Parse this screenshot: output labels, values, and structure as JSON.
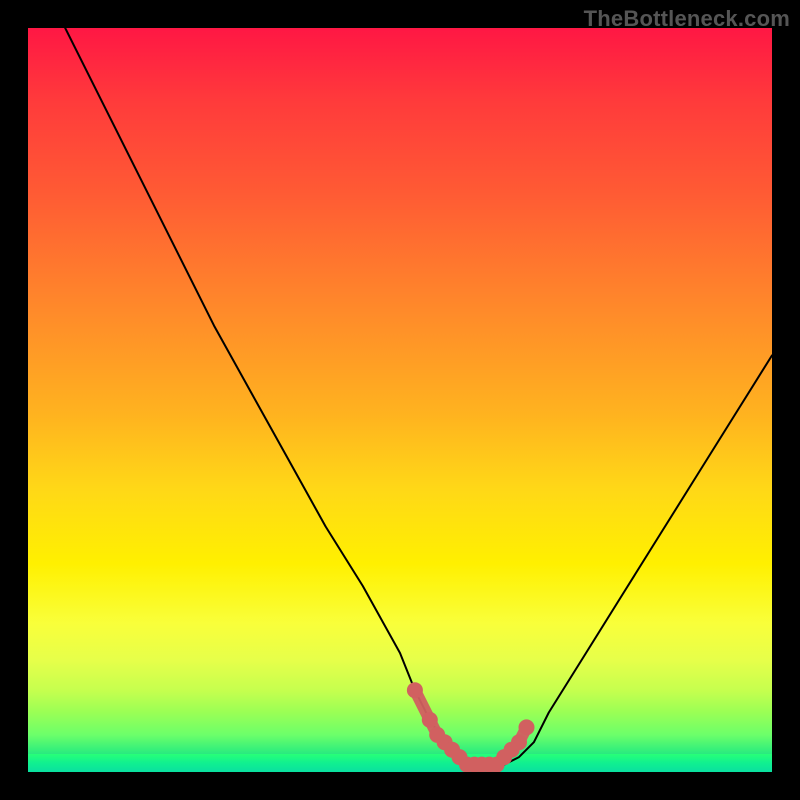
{
  "watermark": "TheBottleneck.com",
  "colors": {
    "frame": "#000000",
    "curve": "#000000",
    "marker_fill": "#d16060",
    "gradient_top": "#ff1744",
    "gradient_mid": "#ffd817",
    "gradient_bottom": "#0adca0"
  },
  "chart_data": {
    "type": "line",
    "title": "",
    "xlabel": "",
    "ylabel": "",
    "xlim": [
      0,
      100
    ],
    "ylim": [
      0,
      100
    ],
    "note": "Image has no axis tick labels; values are normalized 0–100 estimated from pixel positions.",
    "series": [
      {
        "name": "bottleneck-curve",
        "x": [
          5,
          10,
          15,
          20,
          25,
          30,
          35,
          40,
          45,
          50,
          52,
          54,
          56,
          58,
          60,
          62,
          64,
          66,
          68,
          70,
          75,
          80,
          85,
          90,
          95,
          100
        ],
        "values": [
          100,
          90,
          80,
          70,
          60,
          51,
          42,
          33,
          25,
          16,
          11,
          7,
          4,
          2,
          1,
          1,
          1,
          2,
          4,
          8,
          16,
          24,
          32,
          40,
          48,
          56
        ]
      }
    ],
    "markers": [
      {
        "x": 52,
        "y": 11
      },
      {
        "x": 54,
        "y": 7
      },
      {
        "x": 55,
        "y": 5
      },
      {
        "x": 56,
        "y": 4
      },
      {
        "x": 57,
        "y": 3
      },
      {
        "x": 58,
        "y": 2
      },
      {
        "x": 59,
        "y": 1
      },
      {
        "x": 60,
        "y": 1
      },
      {
        "x": 61,
        "y": 1
      },
      {
        "x": 62,
        "y": 1
      },
      {
        "x": 63,
        "y": 1
      },
      {
        "x": 64,
        "y": 2
      },
      {
        "x": 65,
        "y": 3
      },
      {
        "x": 66,
        "y": 4
      },
      {
        "x": 67,
        "y": 6
      }
    ]
  }
}
